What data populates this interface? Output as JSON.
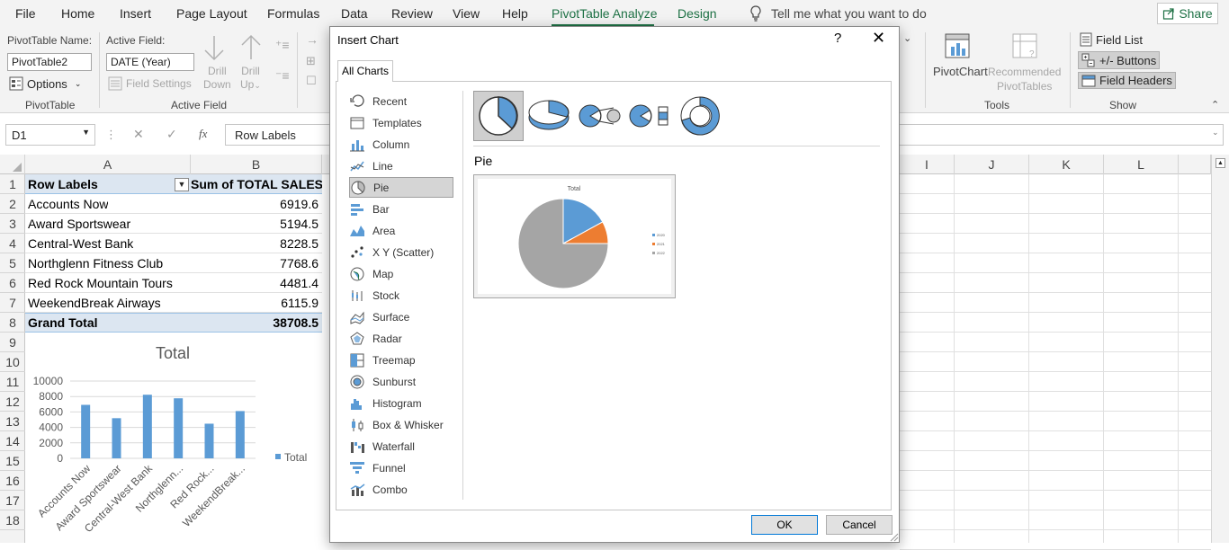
{
  "menubar": {
    "tabs": [
      "File",
      "Home",
      "Insert",
      "Page Layout",
      "Formulas",
      "Data",
      "Review",
      "View",
      "Help",
      "PivotTable Analyze",
      "Design"
    ],
    "active_tab": "PivotTable Analyze",
    "tell_me": "Tell me what you want to do",
    "share": "Share"
  },
  "ribbon": {
    "pivottable_name_label": "PivotTable Name:",
    "pivottable_name_value": "PivotTable2",
    "options": "Options",
    "group_pivottable": "PivotTable",
    "active_field_label": "Active Field:",
    "active_field_value": "DATE (Year)",
    "field_settings": "Field Settings",
    "drill_down": [
      "Drill",
      "Down"
    ],
    "drill_up": [
      "Drill",
      "Up"
    ],
    "group_active_field": "Active Field",
    "pivotchart": "PivotChart",
    "recommended": [
      "Recommended",
      "PivotTables"
    ],
    "group_tools": "Tools",
    "field_list": "Field List",
    "buttons": "+/- Buttons",
    "field_headers": "Field Headers",
    "group_show": "Show"
  },
  "formula_bar": {
    "name_box": "D1",
    "fx": "fx",
    "content": "Row Labels"
  },
  "columns_left": [
    "A",
    "B"
  ],
  "columns_right": [
    "I",
    "J",
    "K",
    "L"
  ],
  "rows": [
    "1",
    "2",
    "3",
    "4",
    "5",
    "6",
    "7",
    "8",
    "9",
    "10",
    "11",
    "12",
    "13",
    "14",
    "15",
    "16",
    "17",
    "18"
  ],
  "pivot": {
    "header_a": "Row Labels",
    "header_b": "Sum of TOTAL SALES",
    "rows": [
      {
        "label": "Accounts Now",
        "value": "6919.6"
      },
      {
        "label": "Award Sportswear",
        "value": "5194.5"
      },
      {
        "label": "Central-West Bank",
        "value": "8228.5"
      },
      {
        "label": "Northglenn Fitness Club",
        "value": "7768.6"
      },
      {
        "label": "Red Rock Mountain Tours",
        "value": "4481.4"
      },
      {
        "label": "WeekendBreak Airways",
        "value": "6115.9"
      }
    ],
    "grand_total_label": "Grand Total",
    "grand_total_value": "38708.5"
  },
  "chart_data": [
    {
      "type": "bar",
      "title": "Total",
      "categories": [
        "Accounts Now",
        "Award Sportswear",
        "Central-West Bank",
        "Northglenn...",
        "Red Rock...",
        "WeekendBreak..."
      ],
      "values": [
        6919.6,
        5194.5,
        8228.5,
        7768.6,
        4481.4,
        6115.9
      ],
      "series": [
        {
          "name": "Total",
          "values": [
            6919.6,
            5194.5,
            8228.5,
            7768.6,
            4481.4,
            6115.9
          ]
        }
      ],
      "yticks": [
        "10000",
        "8000",
        "6000",
        "4000",
        "2000",
        "0"
      ],
      "ylim": [
        0,
        10000
      ],
      "legend": "right",
      "color": "#5b9bd5"
    },
    {
      "type": "pie",
      "title": "Total",
      "slices": [
        {
          "name": "2020",
          "value": 17,
          "color": "#5b9bd5"
        },
        {
          "name": "2021",
          "value": 8,
          "color": "#ed7d31"
        },
        {
          "name": "2022",
          "value": 75,
          "color": "#a5a5a5"
        }
      ],
      "legend": "right"
    }
  ],
  "dialog": {
    "title": "Insert Chart",
    "help": "?",
    "close": "✕",
    "tab": "All Charts",
    "chart_types": [
      "Recent",
      "Templates",
      "Column",
      "Line",
      "Pie",
      "Bar",
      "Area",
      "X Y (Scatter)",
      "Map",
      "Stock",
      "Surface",
      "Radar",
      "Treemap",
      "Sunburst",
      "Histogram",
      "Box & Whisker",
      "Waterfall",
      "Funnel",
      "Combo"
    ],
    "selected_type": "Pie",
    "subtype_title": "Pie",
    "ok": "OK",
    "cancel": "Cancel"
  },
  "colors": {
    "accent": "#1e7145",
    "series_blue": "#5b9bd5",
    "series_orange": "#ed7d31",
    "series_gray": "#a5a5a5",
    "pivot_header": "#dce6f1"
  }
}
